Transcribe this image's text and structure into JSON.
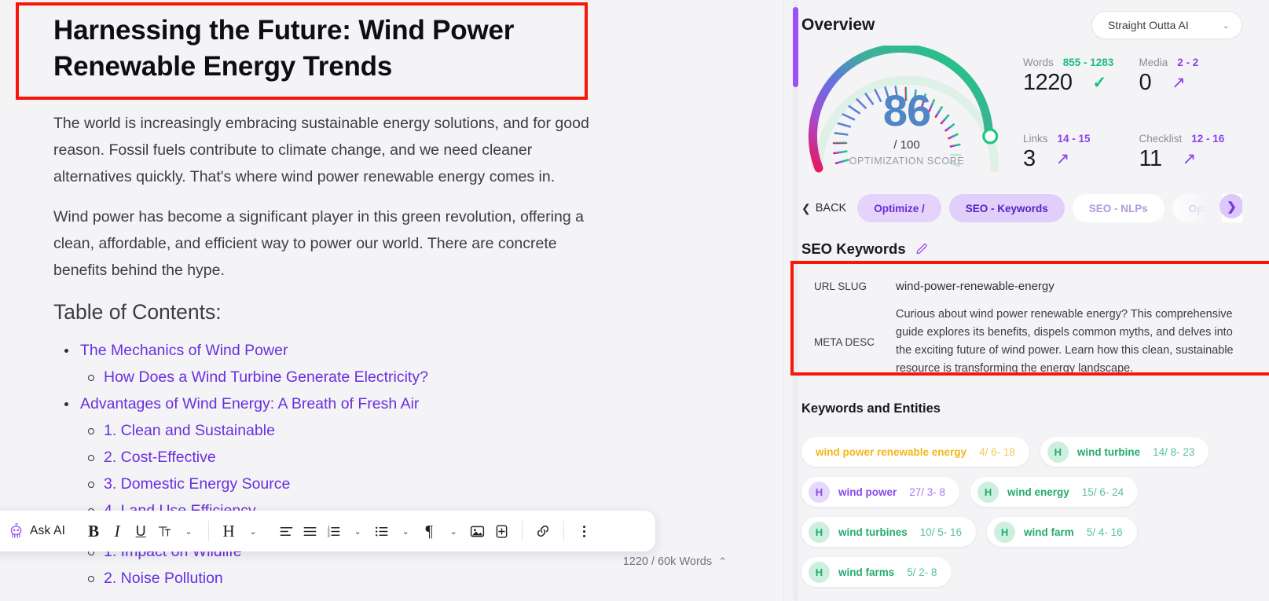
{
  "editor": {
    "title": "Harnessing the Future: Wind Power Renewable Energy Trends",
    "paragraphs": [
      "The world is increasingly embracing sustainable energy solutions, and for good reason. Fossil fuels contribute to climate change, and we need cleaner alternatives quickly. That's where wind power renewable energy comes in.",
      "Wind power has become a significant player in this green revolution, offering a clean, affordable, and efficient way to power our world. There are concrete benefits behind the hype."
    ],
    "toc_heading": "Table of Contents:",
    "toc": [
      {
        "level": 1,
        "label": "The Mechanics of Wind Power"
      },
      {
        "level": 2,
        "label": "How Does a Wind Turbine Generate Electricity?"
      },
      {
        "level": 1,
        "label": "Advantages of Wind Energy: A Breath of Fresh Air"
      },
      {
        "level": 2,
        "label": "1. Clean and Sustainable"
      },
      {
        "level": 2,
        "label": "2. Cost-Effective"
      },
      {
        "level": 2,
        "label": "3. Domestic Energy Source"
      },
      {
        "level": 2,
        "label": "4. Land Use Efficiency"
      }
    ],
    "toc_after_toolbar": [
      {
        "level": 2,
        "label": "1. Impact on Wildlife"
      },
      {
        "level": 2,
        "label": "2. Noise Pollution"
      }
    ],
    "word_count": "1220 / 60k Words"
  },
  "toolbar": {
    "ask_ai": "Ask AI",
    "bold": "B",
    "italic": "I",
    "underline": "U",
    "text_style": "T",
    "heading": "H",
    "align": "align-left",
    "align2": "align-justify",
    "ordered_list": "ordered-list",
    "bullet_list": "bullet-list",
    "paragraph": "¶",
    "image": "image",
    "insert": "+",
    "link": "link",
    "more": "more"
  },
  "overview": {
    "title": "Overview",
    "project_name": "Straight Outta AI",
    "score": "86",
    "score_denominator": "/ 100",
    "score_caption": "OPTIMIZATION SCORE",
    "metrics": [
      {
        "label": "Words",
        "range": "855 - 1283",
        "value": "1220",
        "status": "check",
        "range_color": "green"
      },
      {
        "label": "Media",
        "range": "2 - 2",
        "value": "0",
        "status": "arrow",
        "range_color": "purple"
      },
      {
        "label": "Links",
        "range": "14 - 15",
        "value": "3",
        "status": "arrow",
        "range_color": "purple"
      },
      {
        "label": "Checklist",
        "range": "12 - 16",
        "value": "11",
        "status": "arrow",
        "range_color": "purple"
      }
    ]
  },
  "tabs": {
    "back_label": "BACK",
    "items": [
      {
        "label": "Optimize /",
        "style": "active-light"
      },
      {
        "label": "SEO - Keywords",
        "style": "active-mid"
      },
      {
        "label": "SEO - NLPs",
        "style": "plain"
      },
      {
        "label": "Optimization A",
        "style": "plain"
      }
    ]
  },
  "seo": {
    "section_title": "SEO Keywords",
    "url_slug_label": "URL SLUG",
    "url_slug_value": "wind-power-renewable-energy",
    "meta_desc_label": "META DESC",
    "meta_desc_value": "Curious about wind power renewable energy? This comprehensive guide explores its benefits, dispels common myths, and delves into the exciting future of wind power. Learn how this clean, sustainable resource is transforming the energy landscape."
  },
  "keywords": {
    "title": "Keywords and Entities",
    "chips": [
      {
        "badge": "",
        "badge_color": "",
        "name": "wind power renewable energy",
        "nums": "4/ 6- 18",
        "color": "amber"
      },
      {
        "badge": "H",
        "badge_color": "green",
        "name": "wind turbine",
        "nums": "14/ 8- 23",
        "color": "green"
      },
      {
        "badge": "H",
        "badge_color": "purple",
        "name": "wind power",
        "nums": "27/ 3- 8",
        "color": "purple"
      },
      {
        "badge": "H",
        "badge_color": "green",
        "name": "wind energy",
        "nums": "15/ 6- 24",
        "color": "green"
      },
      {
        "badge": "H",
        "badge_color": "green",
        "name": "wind turbines",
        "nums": "10/ 5- 16",
        "color": "green"
      },
      {
        "badge": "H",
        "badge_color": "green",
        "name": "wind farm",
        "nums": "5/ 4- 16",
        "color": "green"
      },
      {
        "badge": "H",
        "badge_color": "green",
        "name": "wind farms",
        "nums": "5/ 2- 8",
        "color": "green"
      }
    ]
  },
  "colors": {
    "accent_purple": "#9b51f5",
    "link_purple": "#6a2ee0",
    "green": "#19bd7d",
    "amber": "#f2b619",
    "highlight_red": "#fa1508"
  }
}
